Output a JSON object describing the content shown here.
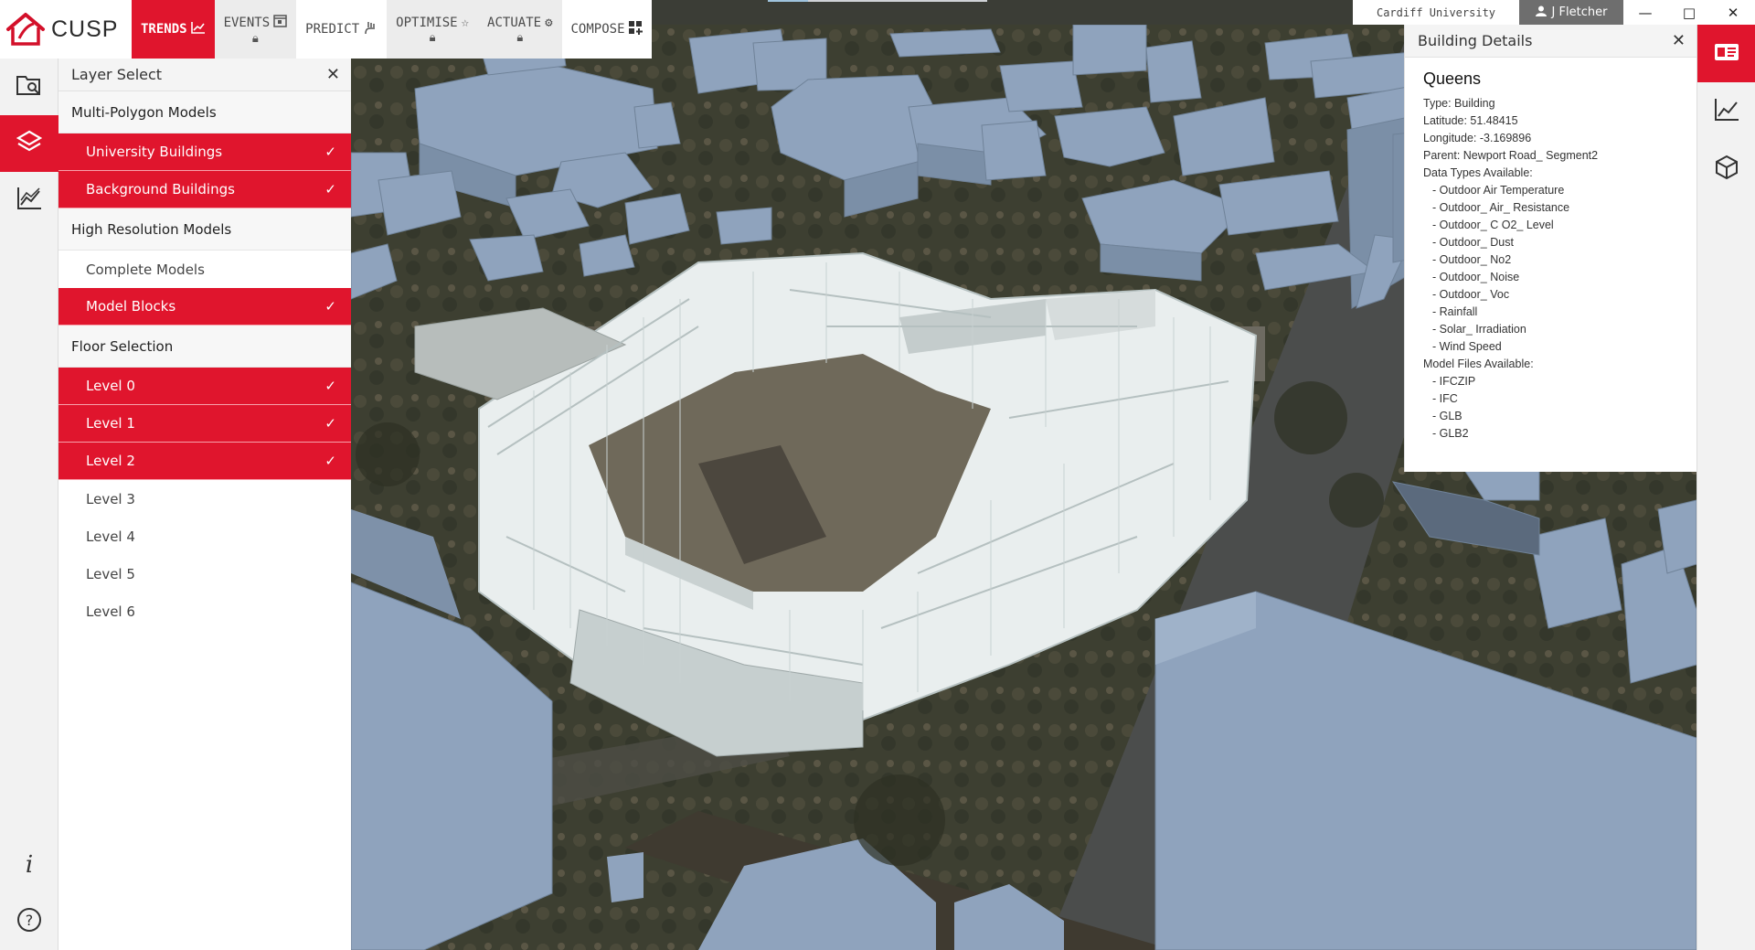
{
  "app": {
    "name": "CUSP"
  },
  "modes": [
    {
      "label": "TRENDS",
      "icon": "chart-line-icon",
      "active": true,
      "locked": false
    },
    {
      "label": "EVENTS",
      "icon": "calendar-icon",
      "active": false,
      "locked": true
    },
    {
      "label": "PREDICT",
      "icon": "predict-hand-icon",
      "active": false,
      "locked": false
    },
    {
      "label": "OPTIMISE",
      "icon": "stars-icon",
      "active": false,
      "locked": true
    },
    {
      "label": "ACTUATE",
      "icon": "gear-icon",
      "active": false,
      "locked": true
    },
    {
      "label": "COMPOSE",
      "icon": "grid-plus-icon",
      "active": false,
      "locked": false
    }
  ],
  "org": "Cardiff University",
  "user": {
    "name": "J Fletcher"
  },
  "window": {
    "minimize": "—",
    "maximize": "□",
    "close": "✕"
  },
  "layer_panel": {
    "title": "Layer Select",
    "sections": [
      {
        "title": "Multi-Polygon Models",
        "items": [
          {
            "label": "University Buildings",
            "checked": true
          },
          {
            "label": "Background Buildings",
            "checked": true
          }
        ]
      },
      {
        "title": "High Resolution Models",
        "items": [
          {
            "label": "Complete Models",
            "checked": false
          },
          {
            "label": "Model Blocks",
            "checked": true
          }
        ]
      },
      {
        "title": "Floor Selection",
        "items": [
          {
            "label": "Level 0",
            "checked": true
          },
          {
            "label": "Level 1",
            "checked": true
          },
          {
            "label": "Level 2",
            "checked": true
          },
          {
            "label": "Level 3",
            "checked": false
          },
          {
            "label": "Level 4",
            "checked": false
          },
          {
            "label": "Level 5",
            "checked": false
          },
          {
            "label": "Level 6",
            "checked": false
          }
        ]
      }
    ]
  },
  "building_details": {
    "title": "Building Details",
    "name": "Queens",
    "type_line": "Type: Building",
    "latitude_line": "Latitude: 51.48415",
    "longitude_line": "Longitude: -3.169896",
    "parent_line": "Parent: Newport Road_ Segment2",
    "data_types_title": "Data Types Available:",
    "data_types": [
      "-  Outdoor Air Temperature",
      "-  Outdoor_ Air_ Resistance",
      "-  Outdoor_ C O2_ Level",
      "-  Outdoor_ Dust",
      "-  Outdoor_ No2",
      "-  Outdoor_ Noise",
      "-  Outdoor_ Voc",
      "-  Rainfall",
      "-  Solar_ Irradiation",
      "-  Wind Speed"
    ],
    "model_files_title": "Model Files Available:",
    "model_files": [
      "-  IFCZIP",
      "-  IFC",
      "-  GLB",
      "-  GLB2"
    ]
  },
  "rail": {
    "top": [
      "map-search-icon",
      "layers-icon",
      "chart-icon"
    ],
    "bottom": [
      "info-icon",
      "help-icon"
    ]
  },
  "right_rail": [
    "building-card-icon",
    "chart-icon",
    "cube-icon"
  ],
  "colors": {
    "accent": "#e0152d",
    "map_buildings": "#8fa3bd",
    "model_blocks": "#e8eeee"
  }
}
